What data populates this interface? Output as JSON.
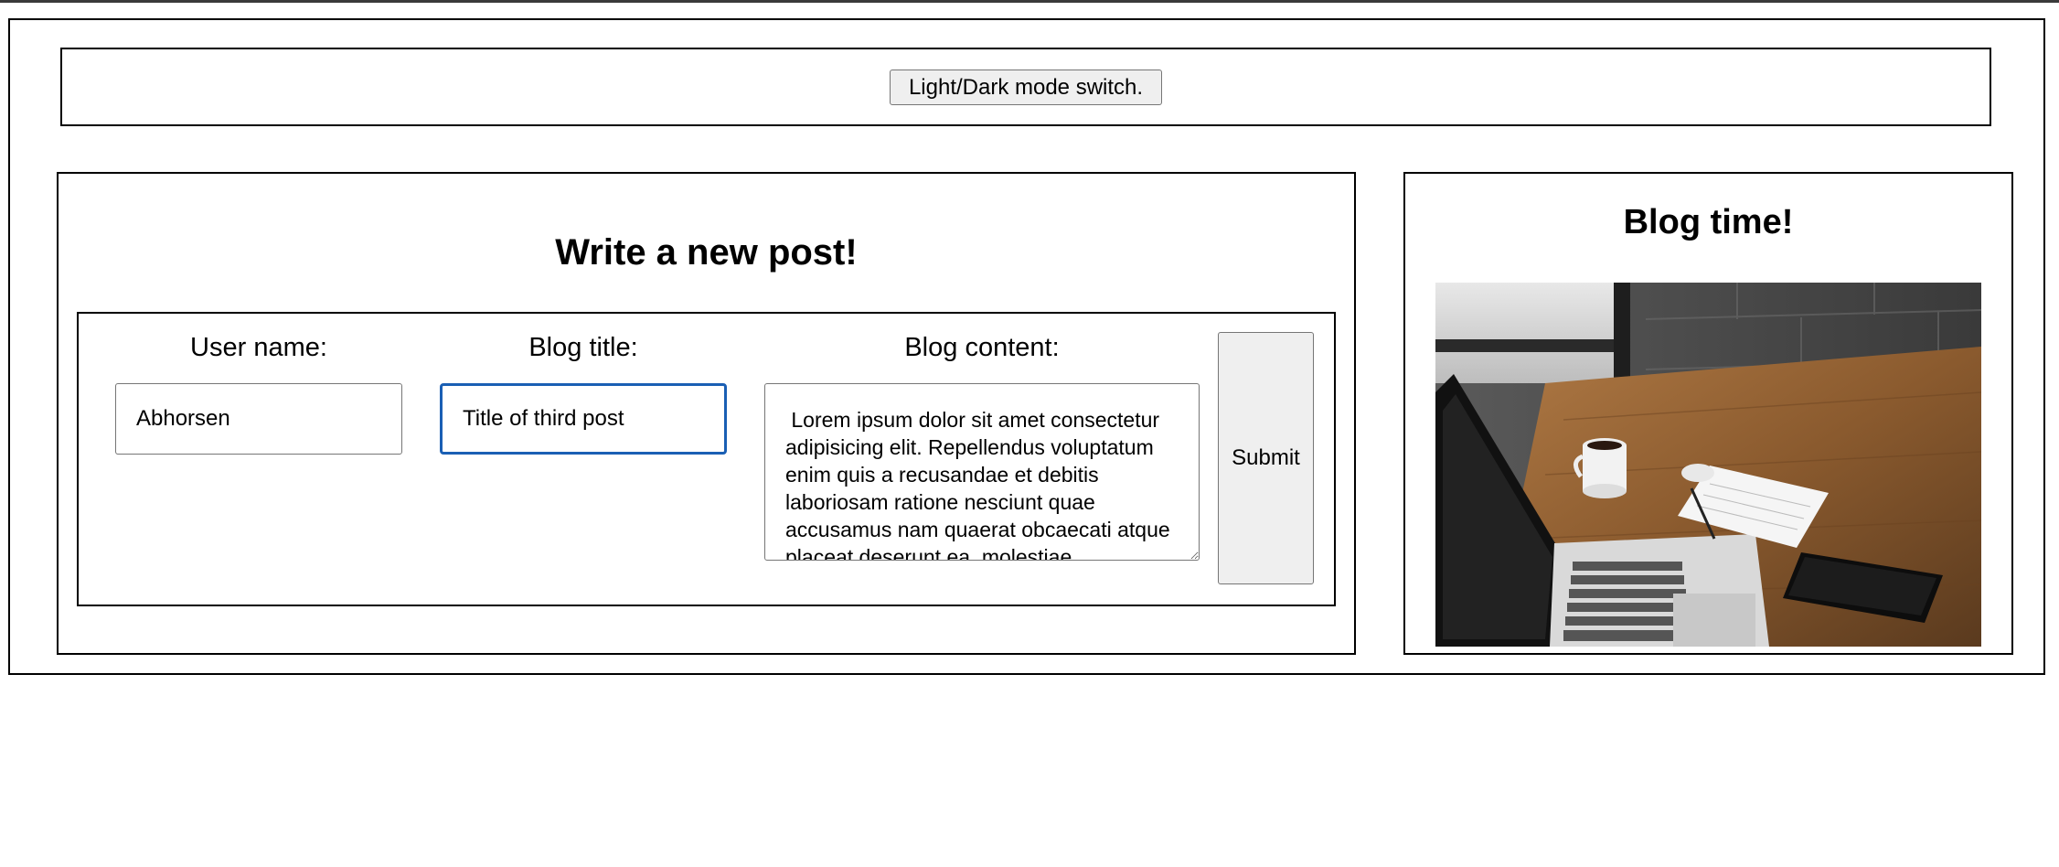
{
  "header": {
    "mode_switch_label": "Light/Dark mode switch."
  },
  "post_form": {
    "heading": "Write a new post!",
    "user_name": {
      "label": "User name:",
      "value": "Abhorsen"
    },
    "blog_title": {
      "label": "Blog title:",
      "value": "Title of third post"
    },
    "blog_content": {
      "label": "Blog content:",
      "value": " Lorem ipsum dolor sit amet consectetur adipisicing elit. Repellendus voluptatum enim quis a recusandae et debitis laboriosam ratione nesciunt quae accusamus nam quaerat obcaecati atque placeat deserunt ea, molestiae"
    },
    "submit_label": "Submit"
  },
  "sidebar": {
    "heading": "Blog time!",
    "image_icon": "desk-photo-laptop-coffee-notepad-phone"
  },
  "colors": {
    "focus_border": "#1a5fb4",
    "button_bg": "#efefef"
  }
}
